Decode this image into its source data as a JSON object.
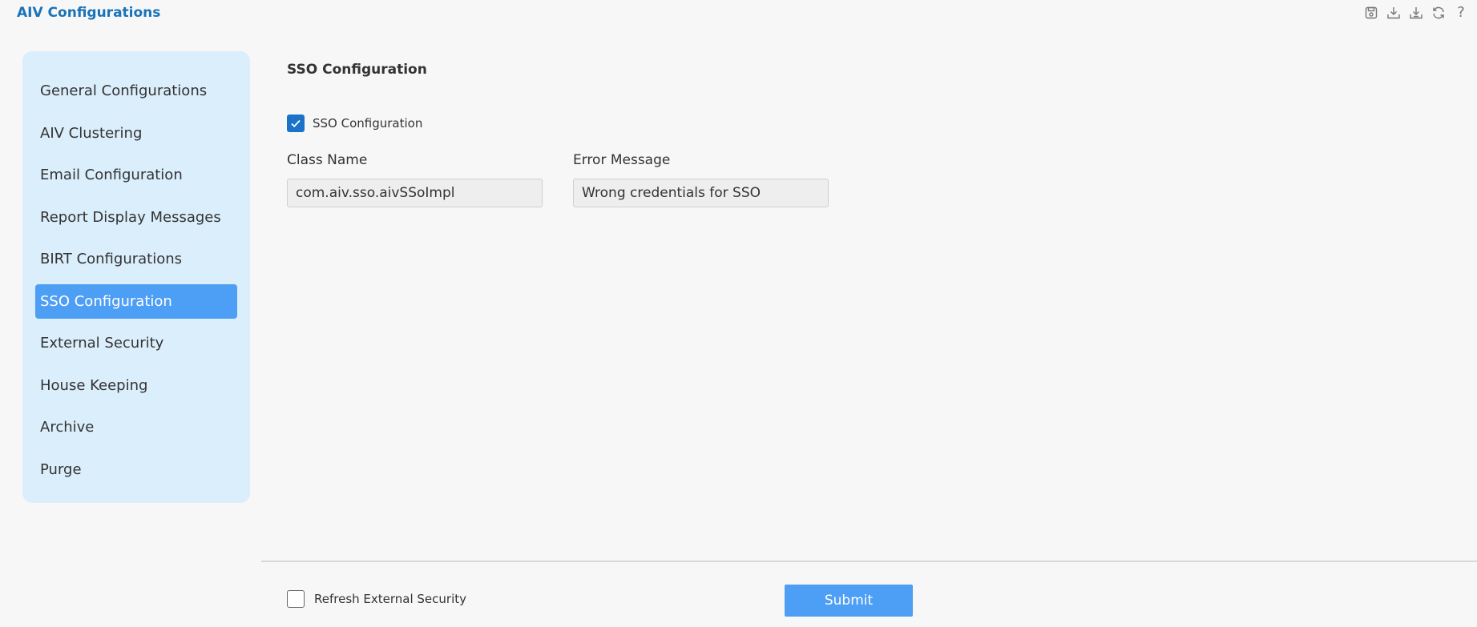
{
  "app": {
    "title": "AIV Configurations"
  },
  "toolbar": {
    "icons": [
      "save-icon",
      "download-icon",
      "download-alt-icon",
      "refresh-icon",
      "help-icon"
    ],
    "help_glyph": "?"
  },
  "sidebar": {
    "items": [
      {
        "label": "General Configurations",
        "active": false
      },
      {
        "label": "AIV Clustering",
        "active": false
      },
      {
        "label": "Email Configuration",
        "active": false
      },
      {
        "label": "Report Display Messages",
        "active": false
      },
      {
        "label": "BIRT Configurations",
        "active": false
      },
      {
        "label": "SSO Configuration",
        "active": true
      },
      {
        "label": "External Security",
        "active": false
      },
      {
        "label": "House Keeping",
        "active": false
      },
      {
        "label": "Archive",
        "active": false
      },
      {
        "label": "Purge",
        "active": false
      }
    ]
  },
  "main": {
    "section_title": "SSO Configuration",
    "sso_checkbox": {
      "label": "SSO Configuration",
      "checked": true
    },
    "class_name": {
      "label": "Class Name",
      "value": "com.aiv.sso.aivSSoImpl"
    },
    "error_message": {
      "label": "Error Message",
      "value": "Wrong credentials for SSO"
    }
  },
  "footer": {
    "refresh_checkbox": {
      "label": "Refresh External Security",
      "checked": false
    },
    "submit_label": "Submit"
  },
  "colors": {
    "accent": "#4d9ef5",
    "title_blue": "#1a73b8",
    "sidebar_bg": "#dbeefc",
    "checkbox_blue": "#1a73c8"
  }
}
